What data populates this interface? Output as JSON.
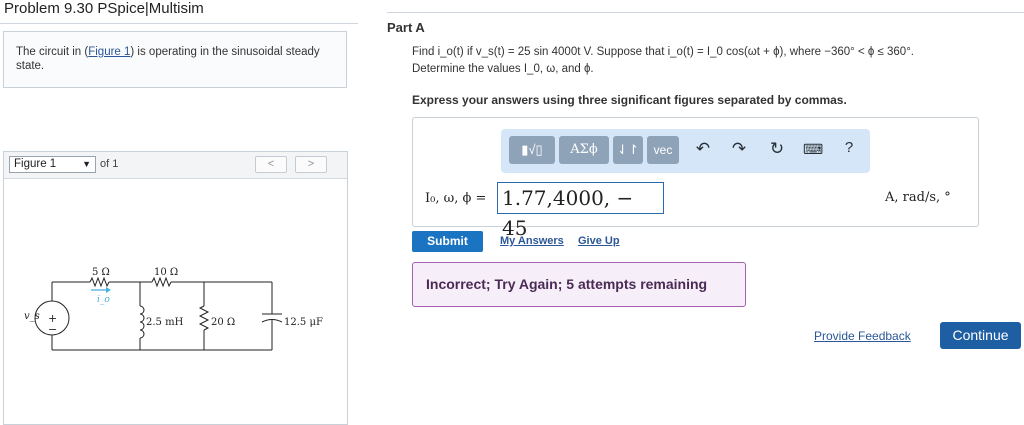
{
  "problem": {
    "title": "Problem 9.30 PSpice|Multisim"
  },
  "intro": {
    "text_before": "The circuit in (",
    "figure_link": "Figure 1",
    "text_after": ") is operating in the sinusoidal steady state."
  },
  "figure": {
    "selected": "Figure 1",
    "of_label": "of 1",
    "prev": "<",
    "next": ">",
    "circuit": {
      "source_label": "v_s",
      "r1_label": "5 Ω",
      "r2_label": "10 Ω",
      "current_label": "i_o",
      "inductor_label": "2.5 mH",
      "r3_label": "20 Ω",
      "capacitor_label": "12.5 μF",
      "plus": "+",
      "minus": "−"
    }
  },
  "part": {
    "label": "Part A",
    "question_line1": "Find i_o(t) if v_s(t) = 25 sin 4000t V. Suppose that i_o(t) = I_0 cos(ωt + ϕ), where −360° < ϕ ≤ 360°.",
    "question_line2": "Determine the values I_0, ω, and ϕ.",
    "instruction": "Express your answers using three significant figures separated by commas."
  },
  "toolbar": {
    "template_btn": "▮√▯",
    "symbols_btn": "ΑΣϕ",
    "arrows_btn": "⇃↾",
    "vec_btn": "vec",
    "undo_icon": "↶",
    "redo_icon": "↷",
    "reset_icon": "↻",
    "keyboard_icon": "⌨",
    "help_icon": "?"
  },
  "answer": {
    "label": "I₀, ω, ϕ =",
    "value": "1.77,4000, − 45",
    "units": "A, rad/s, °"
  },
  "actions": {
    "submit": "Submit",
    "my_answers": "My Answers",
    "give_up": "Give Up"
  },
  "feedback": {
    "message": "Incorrect; Try Again; 5 attempts remaining"
  },
  "footer": {
    "provide_feedback": "Provide Feedback",
    "continue": "Continue"
  },
  "colors": {
    "accent": "#1a74c1",
    "continue_button": "#1e5ea3",
    "feedback_border": "#a262b0",
    "feedback_bg": "#f6eef8",
    "toolbar_bg": "#d4e6f7"
  }
}
